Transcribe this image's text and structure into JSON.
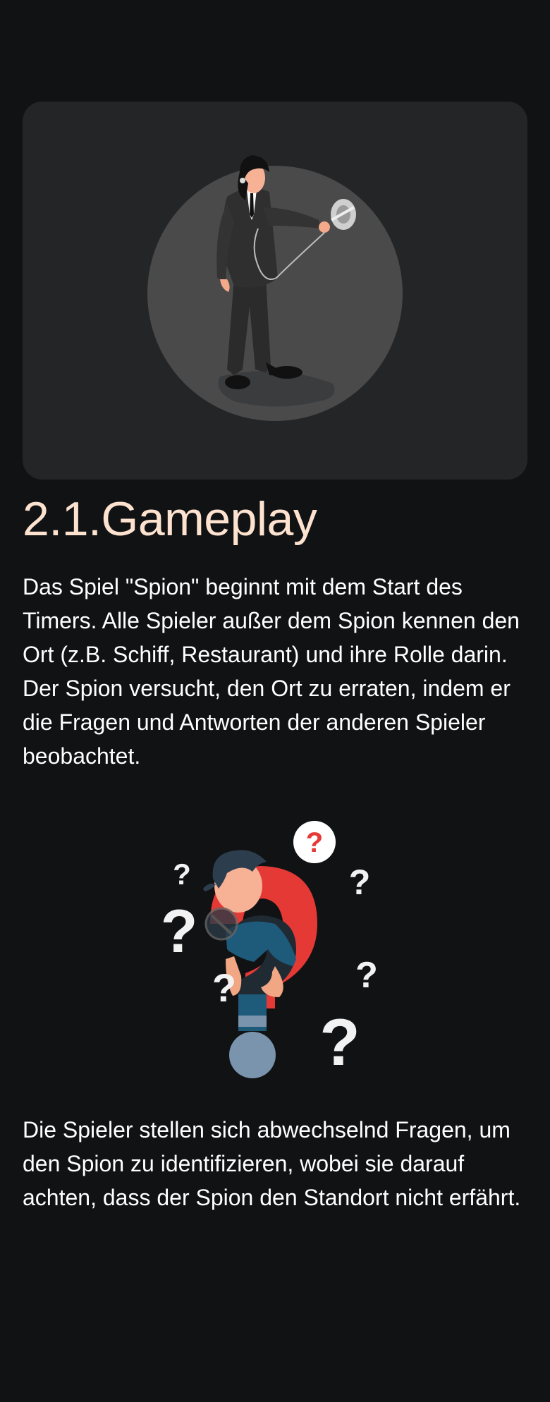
{
  "section": {
    "title": "2.1.Gameplay",
    "paragraph_1": "Das Spiel \"Spion\" beginnt mit dem Start des Timers. Alle Spieler außer dem Spion kennen den Ort (z.B. Schiff, Restaurant) und ihre Rolle darin. Der Spion versucht, den Ort zu erraten, indem er die Fragen und Antworten der anderen Spieler beobachtet.",
    "paragraph_2": "Die Spieler stellen sich abwechselnd Fragen, um den Spion zu identifizieren, wobei sie darauf achten, dass der Spion den Standort nicht erfährt."
  },
  "illustrations": {
    "hero": {
      "icon": "spy-with-listening-device-illustration"
    },
    "second": {
      "icon": "confused-person-question-marks-illustration"
    }
  },
  "colors": {
    "background": "#111214",
    "card": "#242527",
    "title": "#fde3cf",
    "text": "#ffffff",
    "accent_red": "#e53935",
    "shirt_blue": "#1e5a7a"
  }
}
